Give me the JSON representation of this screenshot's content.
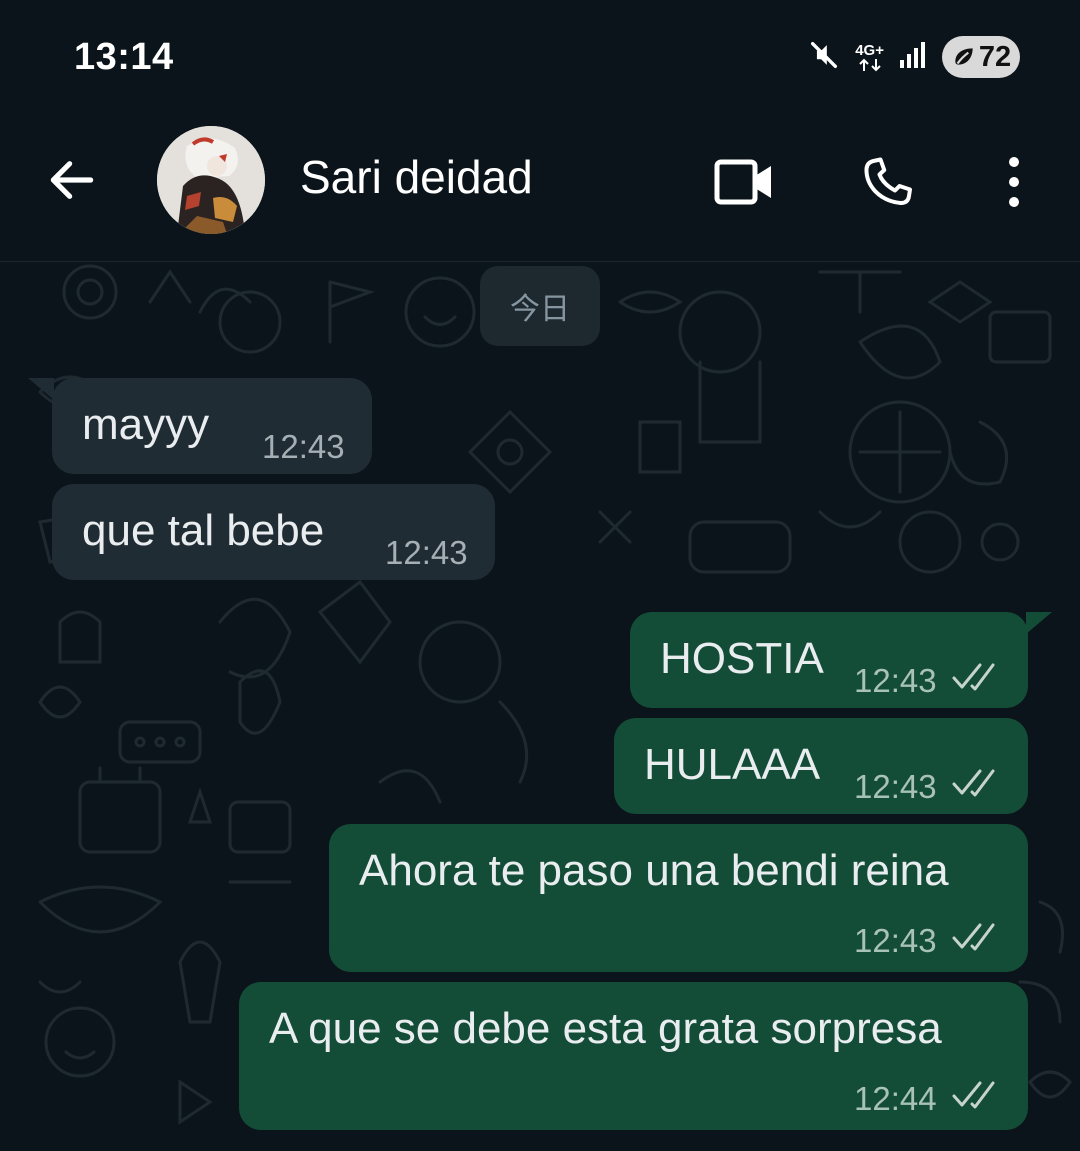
{
  "status_bar": {
    "time": "13:14",
    "network": "4G+",
    "battery": "72"
  },
  "header": {
    "contact_name": "Sari deidad",
    "icons": [
      "back-arrow-icon",
      "video-camera-icon",
      "phone-icon",
      "more-vert-icon"
    ]
  },
  "chat": {
    "date_chip": "今日",
    "messages": [
      {
        "direction": "incoming",
        "text": "mayyy",
        "time": "12:43"
      },
      {
        "direction": "incoming",
        "text": "que tal bebe",
        "time": "12:43"
      },
      {
        "direction": "outgoing",
        "text": "HOSTIA",
        "time": "12:43",
        "status": "delivered"
      },
      {
        "direction": "outgoing",
        "text": "HULAAA",
        "time": "12:43",
        "status": "delivered"
      },
      {
        "direction": "outgoing",
        "text": "Ahora te paso una bendi reina",
        "time": "12:43",
        "status": "delivered"
      },
      {
        "direction": "outgoing",
        "text": "A que se debe esta grata sorpresa",
        "time": "12:44",
        "status": "delivered"
      }
    ]
  },
  "colors": {
    "background": "#0b141a",
    "incoming_bubble": "#202c33",
    "outgoing_bubble": "#144d37",
    "date_chip": "#1d282f"
  }
}
